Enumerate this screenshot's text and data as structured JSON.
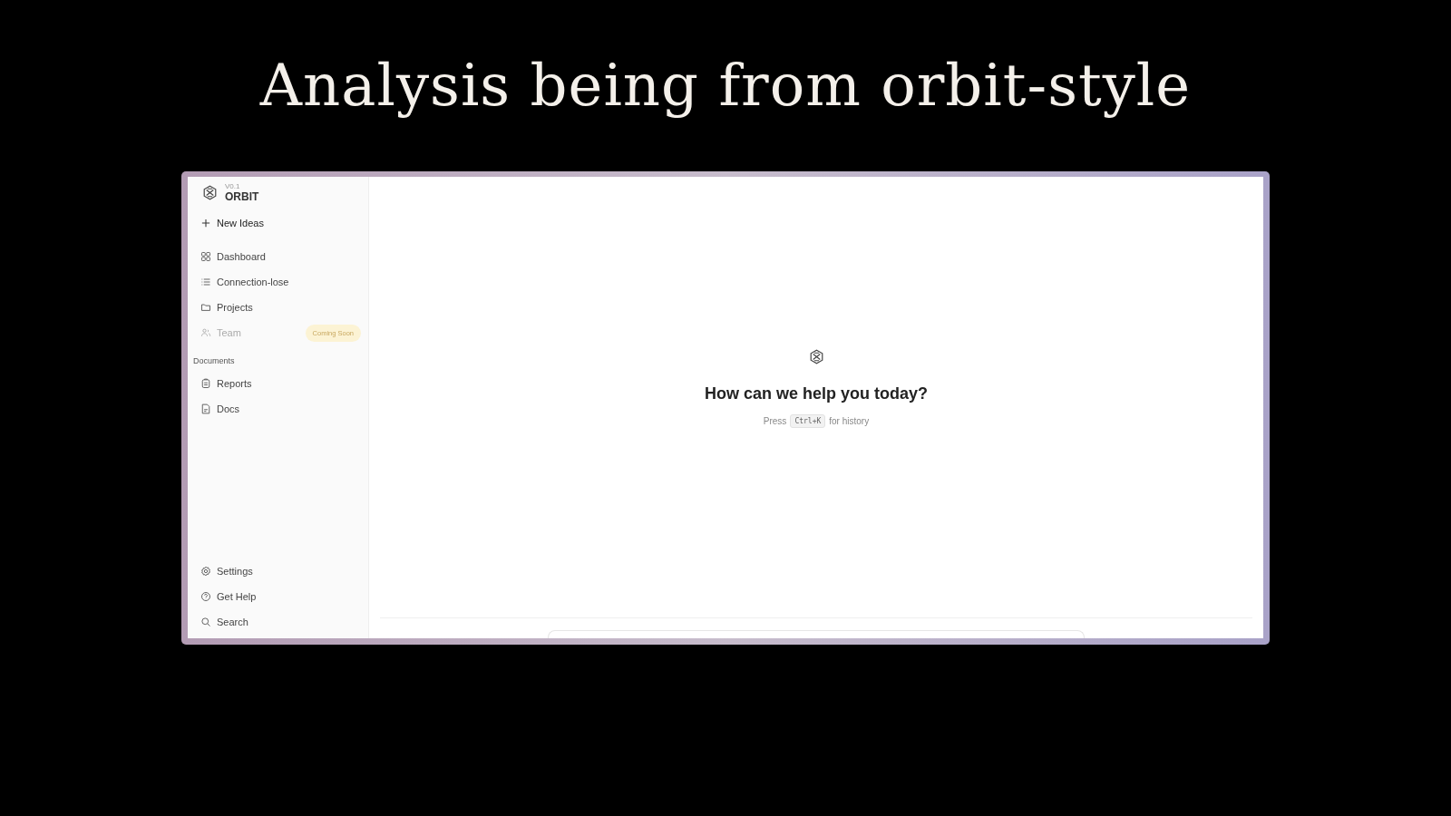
{
  "slide_title": "Analysis being from orbit-style",
  "app": {
    "version": "V0.1",
    "name": "ORBIT",
    "new_button": "New Ideas",
    "nav_items": [
      {
        "label": "Dashboard",
        "disabled": false
      },
      {
        "label": "Connection-lose",
        "disabled": false
      },
      {
        "label": "Projects",
        "disabled": false
      },
      {
        "label": "Team",
        "disabled": true,
        "badge": "Coming Soon"
      }
    ],
    "documents_heading": "Documents",
    "document_items": [
      {
        "label": "Reports"
      },
      {
        "label": "Docs"
      }
    ],
    "footer_items": [
      {
        "label": "Settings"
      },
      {
        "label": "Get Help"
      },
      {
        "label": "Search"
      }
    ],
    "welcome": {
      "heading": "How can we help you today?",
      "hint_before": "Press",
      "shortcut": "Ctrl+K",
      "hint_after": "for history"
    }
  }
}
